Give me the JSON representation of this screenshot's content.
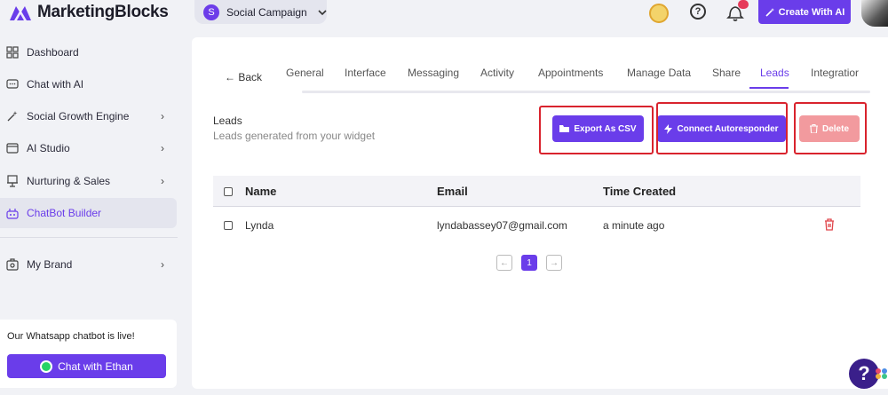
{
  "brand": {
    "name": "MarketingBlocks"
  },
  "campaign": {
    "avatar_letter": "S",
    "name": "Social Campaign"
  },
  "header": {
    "create_ai_label": "Create With AI"
  },
  "sidebar": {
    "items": [
      {
        "label": "Dashboard",
        "icon": "grid-icon"
      },
      {
        "label": "Chat with AI",
        "icon": "chat-icon"
      },
      {
        "label": "Social Growth Engine",
        "icon": "magic-wand-icon",
        "has_submenu": true
      },
      {
        "label": "AI Studio",
        "icon": "ai-studio-icon",
        "has_submenu": true
      },
      {
        "label": "Nurturing & Sales",
        "icon": "presentation-icon",
        "has_submenu": true
      },
      {
        "label": "ChatBot Builder",
        "icon": "robot-icon",
        "active": true
      },
      {
        "label": "My Brand",
        "icon": "brand-icon",
        "has_submenu": true
      }
    ],
    "promo": {
      "text": "Our Whatsapp chatbot is live!",
      "button_label": "Chat with Ethan"
    }
  },
  "tabs": {
    "back_label": "← Back",
    "items": [
      "General",
      "Interface",
      "Messaging",
      "Activity",
      "Appointments",
      "Manage Data",
      "Share",
      "Leads",
      "Integratior"
    ],
    "active": "Leads"
  },
  "leads": {
    "title": "Leads",
    "subtitle": "Leads generated from your widget",
    "export_label": "Export As CSV",
    "connect_label": "Connect Autoresponder",
    "delete_label": "Delete"
  },
  "table": {
    "columns": [
      "Name",
      "Email",
      "Time Created"
    ],
    "rows": [
      {
        "name": "Lynda",
        "email": "lyndabassey07@gmail.com",
        "time": "a minute ago"
      }
    ]
  },
  "pager": {
    "prev": "←",
    "current": "1",
    "next": "→"
  },
  "colors": {
    "accent": "#6a3dea",
    "danger": "#f29a9e",
    "highlight": "#d9232d"
  }
}
